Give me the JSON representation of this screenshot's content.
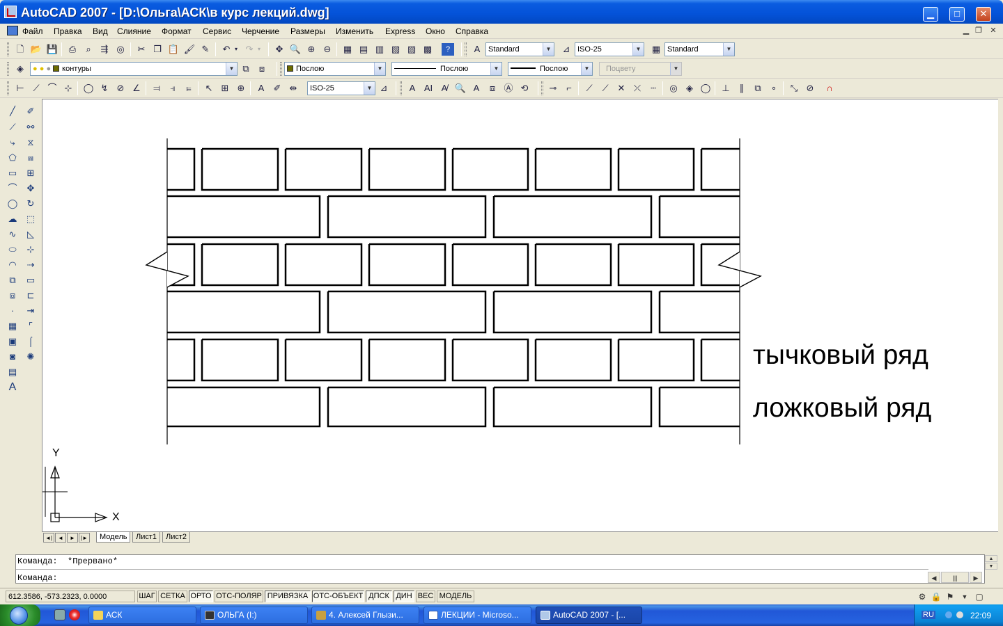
{
  "window": {
    "title": "AutoCAD 2007 - [D:\\Ольга\\АСК\\в курс лекций.dwg]",
    "minimize": "▁",
    "maximize": "□",
    "close": "✕"
  },
  "menu": {
    "items": [
      "Файл",
      "Правка",
      "Вид",
      "Слияние",
      "Формат",
      "Сервис",
      "Черчение",
      "Размеры",
      "Изменить",
      "Express",
      "Окно",
      "Справка"
    ],
    "mdi_controls": [
      "▁",
      "❐",
      "✕"
    ]
  },
  "toolbar_standard": {
    "text_style": "Standard",
    "dim_style": "ISO-25",
    "table_style": "Standard"
  },
  "toolbar_layers": {
    "layer_name": "контуры",
    "layer_color": "#6b6b00",
    "color": "Послою",
    "linetype": "Послою",
    "lineweight": "Послою",
    "plot_style": "Поцвету"
  },
  "toolbar_dimension": {
    "dim_style": "ISO-25"
  },
  "drawing": {
    "labels": {
      "header_row": "тычковый ряд",
      "stretcher_row": "ложковый ряд"
    },
    "ucs": {
      "x_label": "X",
      "y_label": "Y"
    }
  },
  "layout_tabs": {
    "nav": [
      "◄|",
      "◄",
      "►",
      "|►"
    ],
    "tabs": [
      "Модель",
      "Лист1",
      "Лист2"
    ]
  },
  "command": {
    "history": "Команда:  *Прервано*",
    "prompt": "Команда:"
  },
  "status": {
    "coords": "612.3586, -573.2323, 0.0000",
    "buttons": [
      "ШАГ",
      "СЕТКА",
      "ОРТО",
      "ОТС-ПОЛЯР",
      "ПРИВЯЗКА",
      "ОТС-ОБЪЕКТ",
      "ДПСК",
      "ДИН",
      "ВЕС",
      "МОДЕЛЬ"
    ]
  },
  "taskbar": {
    "tasks": [
      "АСК",
      "ОЛЬГА (I:)",
      "4. Алексей Глызи...",
      "ЛЕКЦИИ - Microso...",
      "AutoCAD 2007 - [..."
    ],
    "lang": "RU",
    "clock": "22:09"
  }
}
